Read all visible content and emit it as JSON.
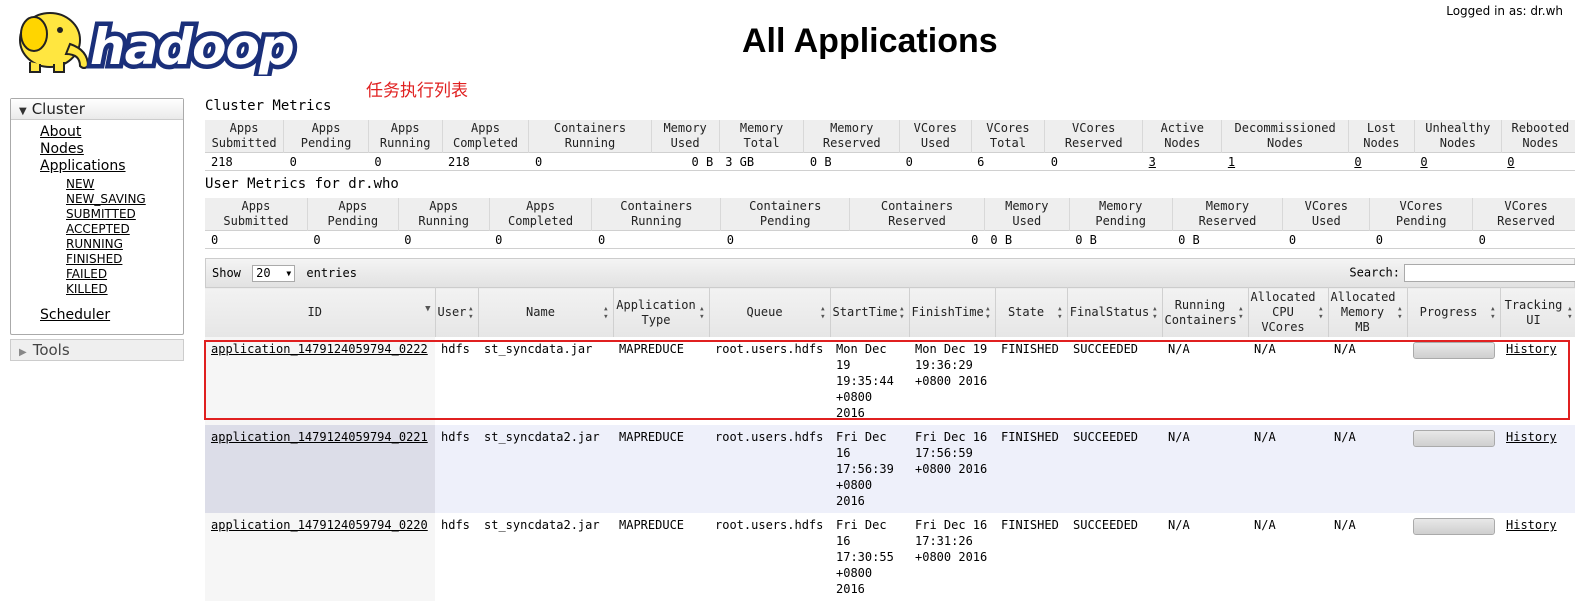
{
  "header": {
    "logo_text": "hadoop",
    "title": "All Applications",
    "logged_in": "Logged in as: dr.wh",
    "annotation": "任务执行列表"
  },
  "sidebar": {
    "cluster_label": "Cluster",
    "links": [
      "About",
      "Nodes",
      "Applications"
    ],
    "app_states": [
      "NEW",
      "NEW_SAVING",
      "SUBMITTED",
      "ACCEPTED",
      "RUNNING",
      "FINISHED",
      "FAILED",
      "KILLED"
    ],
    "scheduler": "Scheduler",
    "tools_label": "Tools"
  },
  "cluster_metrics": {
    "title": "Cluster Metrics",
    "headers": [
      [
        "Apps",
        "Submitted"
      ],
      [
        "Apps",
        "Pending"
      ],
      [
        "Apps",
        "Running"
      ],
      [
        "Apps",
        "Completed"
      ],
      [
        "Containers",
        "Running"
      ],
      [
        "Memory",
        "Used"
      ],
      [
        "Memory",
        "Total"
      ],
      [
        "Memory",
        "Reserved"
      ],
      [
        "VCores",
        "Used"
      ],
      [
        "VCores",
        "Total"
      ],
      [
        "VCores",
        "Reserved"
      ],
      [
        "Active",
        "Nodes"
      ],
      [
        "Decommissioned",
        "Nodes"
      ],
      [
        "Lost",
        "Nodes"
      ],
      [
        "Unhealthy",
        "Nodes"
      ],
      [
        "Rebooted",
        "Nodes"
      ]
    ],
    "values": [
      "218",
      "0",
      "0",
      "218",
      "0",
      "0 B",
      "3 GB",
      "0 B",
      "0",
      "6",
      "0",
      "3",
      "1",
      "0",
      "0",
      "0"
    ]
  },
  "user_metrics": {
    "title": "User Metrics for dr.who",
    "headers": [
      [
        "Apps",
        "Submitted"
      ],
      [
        "Apps",
        "Pending"
      ],
      [
        "Apps",
        "Running"
      ],
      [
        "Apps",
        "Completed"
      ],
      [
        "Containers",
        "Running"
      ],
      [
        "Containers",
        "Pending"
      ],
      [
        "Containers",
        "Reserved"
      ],
      [
        "Memory",
        "Used"
      ],
      [
        "Memory",
        "Pending"
      ],
      [
        "Memory",
        "Reserved"
      ],
      [
        "VCores",
        "Used"
      ],
      [
        "VCores",
        "Pending"
      ],
      [
        "VCores",
        "Reserved"
      ]
    ],
    "values": [
      "0",
      "0",
      "0",
      "0",
      "0",
      "0",
      "0",
      "0 B",
      "0 B",
      "0 B",
      "0",
      "0",
      "0"
    ]
  },
  "apps_table": {
    "show_label": "Show",
    "page_size": "20",
    "entries_label": "entries",
    "search_label": "Search:",
    "columns": [
      "ID",
      "User",
      "Name",
      "Application Type",
      "Queue",
      "StartTime",
      "FinishTime",
      "State",
      "FinalStatus",
      "Running Containers",
      "Allocated CPU VCores",
      "Allocated Memory MB",
      "Progress",
      "Tracking UI"
    ],
    "rows": [
      {
        "id": "application_1479124059794_0222",
        "user": "hdfs",
        "name": "st_syncdata.jar",
        "type": "MAPREDUCE",
        "queue": "root.users.hdfs",
        "start": "Mon Dec 19 19:35:44 +0800 2016",
        "finish": "Mon Dec 19 19:36:29 +0800 2016",
        "state": "FINISHED",
        "final_status": "SUCCEEDED",
        "running_containers": "N/A",
        "cpu": "N/A",
        "memory": "N/A",
        "progress": 1.0,
        "tracking": "History"
      },
      {
        "id": "application_1479124059794_0221",
        "user": "hdfs",
        "name": "st_syncdata2.jar",
        "type": "MAPREDUCE",
        "queue": "root.users.hdfs",
        "start": "Fri Dec 16 17:56:39 +0800 2016",
        "finish": "Fri Dec 16 17:56:59 +0800 2016",
        "state": "FINISHED",
        "final_status": "SUCCEEDED",
        "running_containers": "N/A",
        "cpu": "N/A",
        "memory": "N/A",
        "progress": 1.0,
        "tracking": "History"
      },
      {
        "id": "application_1479124059794_0220",
        "user": "hdfs",
        "name": "st_syncdata2.jar",
        "type": "MAPREDUCE",
        "queue": "root.users.hdfs",
        "start": "Fri Dec 16 17:30:55 +0800 2016",
        "finish": "Fri Dec 16 17:31:26 +0800 2016",
        "state": "FINISHED",
        "final_status": "SUCCEEDED",
        "running_containers": "N/A",
        "cpu": "N/A",
        "memory": "N/A",
        "progress": 1.0,
        "tracking": "History"
      }
    ]
  }
}
